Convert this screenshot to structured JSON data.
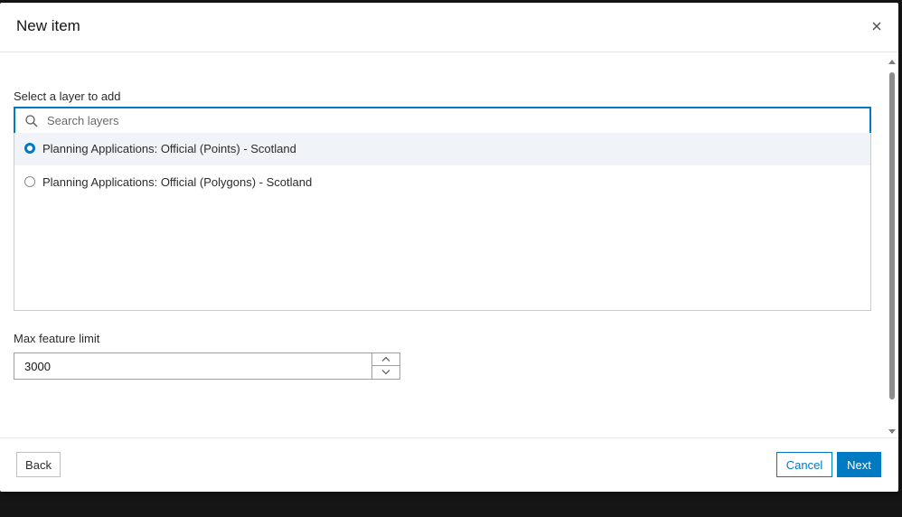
{
  "modal": {
    "title": "New item"
  },
  "layer_picker": {
    "label": "Select a layer to add",
    "search_placeholder": "Search layers",
    "search_value": "",
    "items": [
      {
        "label": "Planning Applications: Official (Points) - Scotland",
        "selected": true
      },
      {
        "label": "Planning Applications: Official (Polygons) - Scotland",
        "selected": false
      }
    ]
  },
  "feature_limit": {
    "label": "Max feature limit",
    "value": "3000"
  },
  "footer": {
    "back_label": "Back",
    "cancel_label": "Cancel",
    "next_label": "Next"
  },
  "colors": {
    "accent": "#007ac2",
    "selected_row": "#f0f4f8",
    "text": "#151515"
  },
  "icons": {
    "close": "close-icon",
    "search": "search-icon",
    "stepper_up": "chevron-up-icon",
    "stepper_down": "chevron-down-icon"
  }
}
